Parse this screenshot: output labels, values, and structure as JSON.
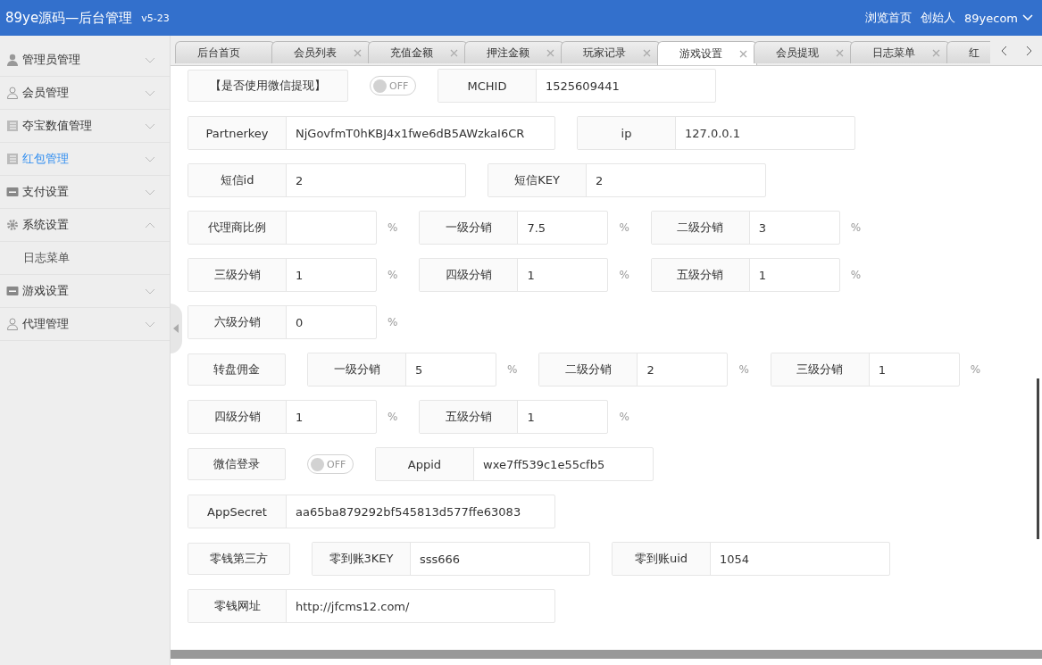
{
  "header": {
    "title": "89ye源码—后台管理",
    "version": "v5-23",
    "links": [
      "浏览首页",
      "创始人"
    ],
    "user": "89yecom"
  },
  "sidebar": {
    "items": [
      {
        "label": "管理员管理",
        "selected": false,
        "expanded": false
      },
      {
        "label": "会员管理",
        "selected": false,
        "expanded": false
      },
      {
        "label": "夺宝数值管理",
        "selected": false,
        "expanded": false
      },
      {
        "label": "红包管理",
        "selected": true,
        "expanded": false
      },
      {
        "label": "支付设置",
        "selected": false,
        "expanded": false
      },
      {
        "label": "系统设置",
        "selected": false,
        "expanded": true,
        "children": [
          {
            "label": "日志菜单",
            "selected": false
          }
        ]
      },
      {
        "label": "游戏设置",
        "selected": false,
        "expanded": false
      },
      {
        "label": "代理管理",
        "selected": false,
        "expanded": false
      }
    ]
  },
  "tabs": [
    {
      "label": "后台首页",
      "selected": false,
      "closable": false
    },
    {
      "label": "会员列表",
      "selected": false,
      "closable": true
    },
    {
      "label": "充值金额",
      "selected": false,
      "closable": true
    },
    {
      "label": "押注金额",
      "selected": false,
      "closable": true
    },
    {
      "label": "玩家记录",
      "selected": false,
      "closable": true
    },
    {
      "label": "游戏设置",
      "selected": true,
      "closable": true
    },
    {
      "label": "会员提现",
      "selected": false,
      "closable": true
    },
    {
      "label": "日志菜单",
      "selected": false,
      "closable": true
    },
    {
      "label": "红",
      "selected": false
    }
  ],
  "form": {
    "rows": [
      {
        "items": [
          {
            "kind": "label",
            "text": "【是否使用微信提现】"
          },
          {
            "kind": "switch",
            "text": "OFF",
            "on": false
          },
          {
            "kind": "field",
            "label": "MCHID",
            "value": "1525609441"
          }
        ]
      },
      {
        "items": [
          {
            "kind": "field",
            "label": "Partnerkey",
            "value": "NjGovfmT0hKBJ4x1fwe6dB5AWzkaI6CR",
            "wide": true
          },
          {
            "kind": "field",
            "label": "ip",
            "value": "127.0.0.1"
          }
        ]
      },
      {
        "items": [
          {
            "kind": "field",
            "label": "短信id",
            "value": "2"
          },
          {
            "kind": "field",
            "label": "短信KEY",
            "value": "2"
          }
        ]
      },
      {
        "items": [
          {
            "kind": "field",
            "label": "代理商比例",
            "unit": "%"
          },
          {
            "kind": "field",
            "label": "一级分销",
            "value": "7.5",
            "unit": "%"
          },
          {
            "kind": "field",
            "label": "二级分销",
            "value": "3",
            "unit": "%"
          }
        ]
      },
      {
        "items": [
          {
            "kind": "field",
            "label": "三级分销",
            "value": "1",
            "unit": "%"
          },
          {
            "kind": "field",
            "label": "四级分销",
            "value": "1",
            "unit": "%"
          },
          {
            "kind": "field",
            "label": "五级分销",
            "value": "1",
            "unit": "%"
          }
        ]
      },
      {
        "items": [
          {
            "kind": "field",
            "label": "六级分销",
            "value": "0",
            "unit": "%"
          }
        ]
      },
      {
        "items": [
          {
            "kind": "label",
            "text": "转盘佣金"
          },
          {
            "kind": "field",
            "label": "一级分销",
            "value": "5",
            "unit": "%"
          },
          {
            "kind": "field",
            "label": "二级分销",
            "value": "2",
            "unit": "%"
          },
          {
            "kind": "field",
            "label": "三级分销",
            "value": "1",
            "unit": "%"
          }
        ]
      },
      {
        "items": [
          {
            "kind": "field",
            "label": "四级分销",
            "value": "1",
            "unit": "%"
          },
          {
            "kind": "field",
            "label": "五级分销",
            "value": "1",
            "unit": "%"
          }
        ]
      },
      {
        "items": [
          {
            "kind": "label",
            "text": "微信登录"
          },
          {
            "kind": "switch",
            "text": "OFF",
            "on": false
          },
          {
            "kind": "field",
            "label": "Appid",
            "value": "wxe7ff539c1e55cfb5"
          }
        ]
      },
      {
        "items": [
          {
            "kind": "field",
            "label": "AppSecret",
            "value": "aa65ba879292bf545813d577ffe63083",
            "wide": true
          }
        ]
      },
      {
        "items": [
          {
            "kind": "label",
            "text": "零钱第三方"
          },
          {
            "kind": "field",
            "label": "零到账3KEY",
            "value": "sss666"
          },
          {
            "kind": "field",
            "label": "零到账uid",
            "value": "1054"
          }
        ]
      },
      {
        "items": [
          {
            "kind": "field",
            "label": "零钱网址",
            "value": "http://jfcms12.com/",
            "wide": true
          }
        ]
      }
    ]
  }
}
